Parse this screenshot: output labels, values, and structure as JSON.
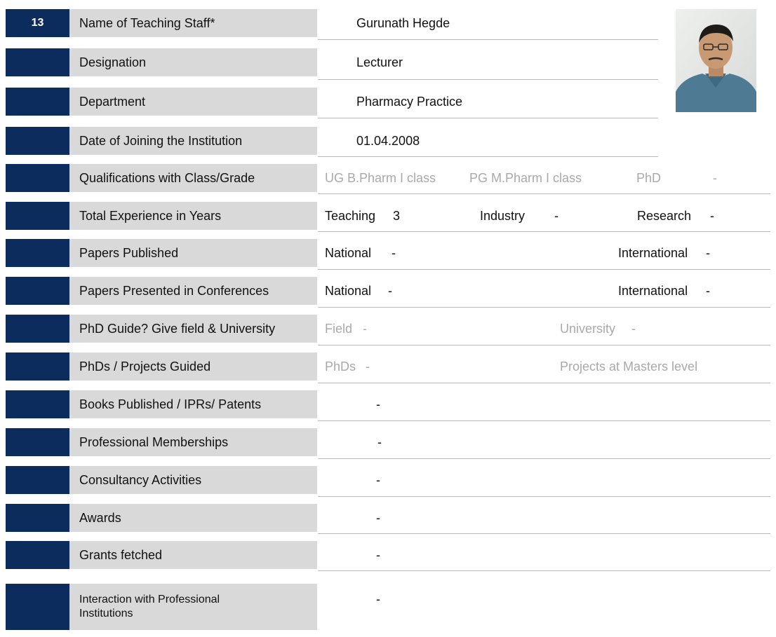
{
  "rows": [
    {
      "num": "13",
      "label": "Name of Teaching Staff*"
    },
    {
      "num": "",
      "label": "Designation"
    },
    {
      "num": "",
      "label": "Department"
    },
    {
      "num": "",
      "label": "Date of Joining the Institution"
    },
    {
      "num": "",
      "label": "Qualifications with Class/Grade"
    },
    {
      "num": "",
      "label": "Total Experience in Years"
    },
    {
      "num": "",
      "label": "Papers Published"
    },
    {
      "num": "",
      "label": "Papers Presented in Conferences"
    },
    {
      "num": "",
      "label": "PhD Guide? Give field & University"
    },
    {
      "num": "",
      "label": "PhDs / Projects Guided"
    },
    {
      "num": "",
      "label": "Books Published / IPRs/ Patents"
    },
    {
      "num": "",
      "label": "Professional Memberships"
    },
    {
      "num": "",
      "label": "Consultancy Activities"
    },
    {
      "num": "",
      "label": "Awards"
    },
    {
      "num": "",
      "label": "Grants fetched"
    },
    {
      "num": "",
      "label": "Interaction with Professional Institutions"
    }
  ],
  "values": {
    "name": "Gurunath Hegde",
    "designation": "Lecturer",
    "department": "Pharmacy Practice",
    "date_of_joining": "01.04.2008",
    "qualifications": {
      "ug": "UG B.Pharm I class",
      "pg": "PG M.Pharm I class",
      "phd_label": "PhD",
      "phd_value": "-"
    },
    "experience": {
      "teaching_label": "Teaching",
      "teaching_value": "3",
      "industry_label": "Industry",
      "industry_value": "-",
      "research_label": "Research",
      "research_value": "-"
    },
    "papers_published": {
      "national_label": "National",
      "national_value": "-",
      "international_label": "International",
      "international_value": "-"
    },
    "papers_presented": {
      "national_label": "National",
      "national_value": "-",
      "international_label": "International",
      "international_value": "-"
    },
    "phd_guide": {
      "field_label": "Field",
      "field_value": "-",
      "university_label": "University",
      "university_value": "-"
    },
    "phds_guided": {
      "phds_label": "PhDs",
      "phds_value": "-",
      "projects_label": "Projects at Masters level"
    },
    "books": "-",
    "memberships": "-",
    "consultancy": "-",
    "awards": "-",
    "grants": "-",
    "interaction": "-"
  },
  "colors": {
    "number_block": "#0d2c5e",
    "label_cell": "#d9d9d9",
    "grey_text": "#a9a9a9"
  }
}
